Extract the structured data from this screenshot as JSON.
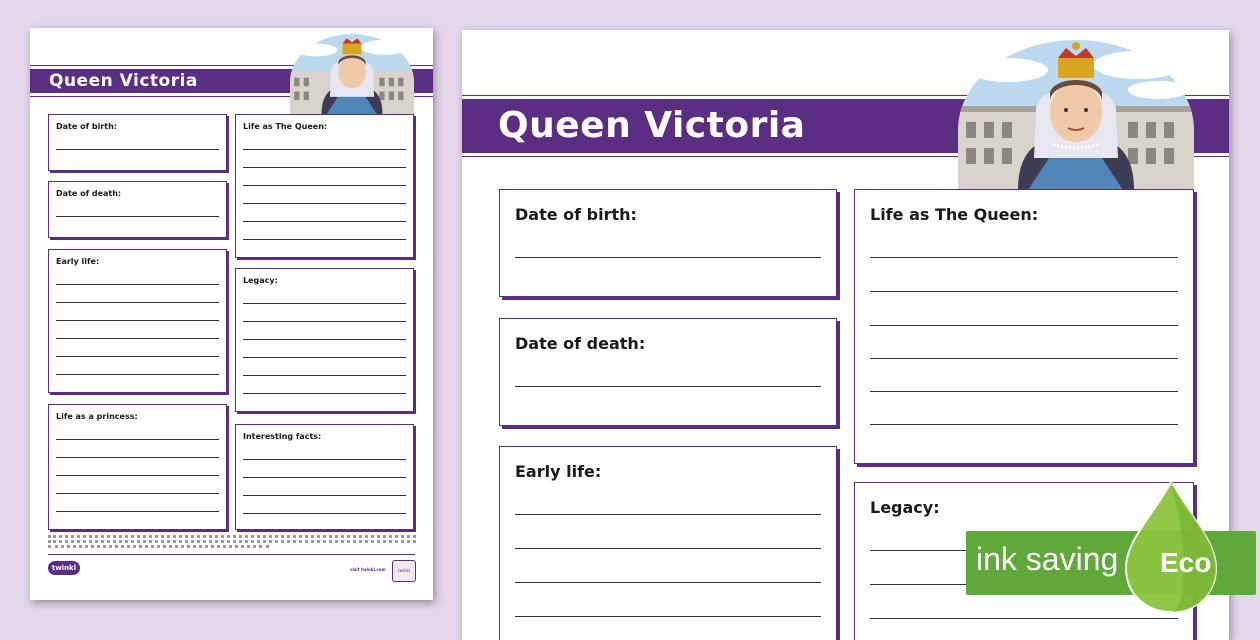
{
  "worksheet": {
    "title": "Queen Victoria",
    "boxes": {
      "birth": "Date of birth:",
      "death": "Date of death:",
      "early": "Early life:",
      "princess": "Life as a princess:",
      "queen": "Life as The Queen:",
      "legacy": "Legacy:",
      "facts": "Interesting facts:"
    },
    "logo_text": "twinkl",
    "visit_text": "visit twinkl.com",
    "badge_text": "twinkl"
  },
  "eco": {
    "text": "ink saving",
    "label": "Eco"
  },
  "colors": {
    "accent": "#5b2e83",
    "background": "#e3d7ea",
    "eco_green": "#5fa83a"
  }
}
